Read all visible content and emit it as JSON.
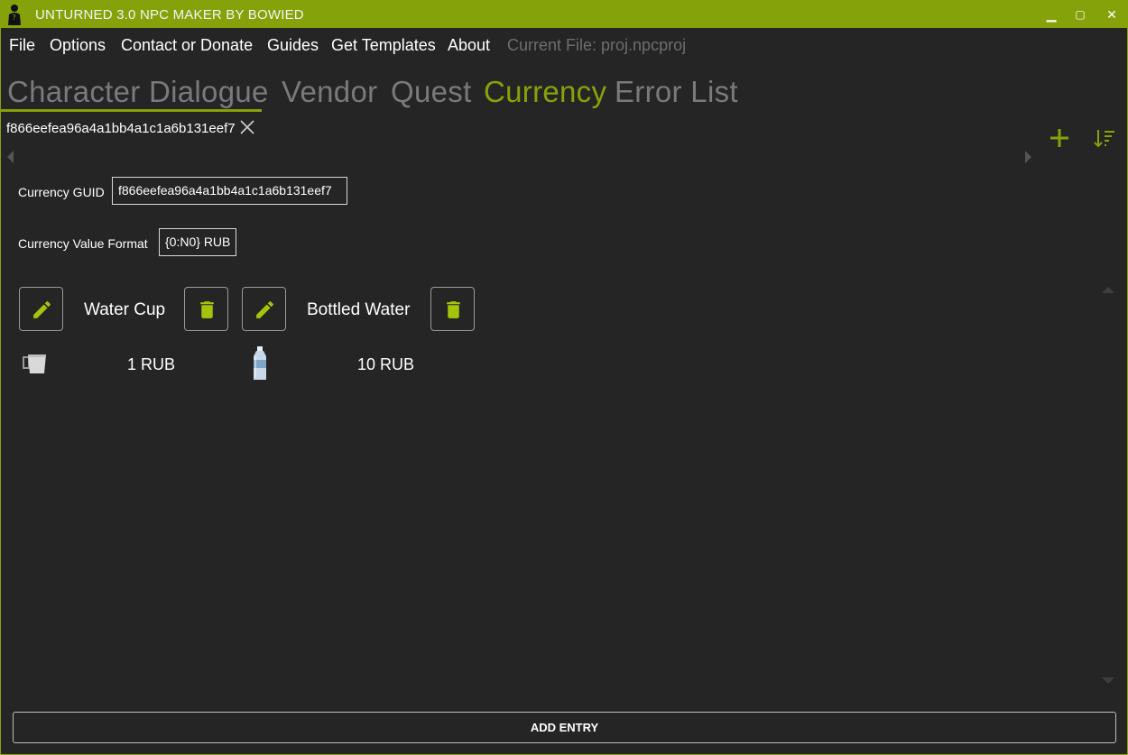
{
  "window": {
    "title": "UNTURNED 3.0 NPC MAKER BY BOWIED",
    "icon": "npc-silhouette-icon",
    "controls": {
      "minimize": "▁",
      "maximize": "▢",
      "close": "✕"
    }
  },
  "menu": {
    "items": [
      "File",
      "Options",
      "Contact or Donate",
      "Guides",
      "Get Templates",
      "About"
    ],
    "current_file": "Current File: proj.npcproj"
  },
  "tabs": {
    "items": [
      "Character",
      "Dialogue",
      "Vendor",
      "Quest",
      "Currency",
      "Error List"
    ],
    "active": "Currency"
  },
  "subtab": {
    "label": "f866eefea96a4a1bb4a1c1a6b131eef7"
  },
  "form": {
    "guid_label": "Currency GUID",
    "guid_value": "f866eefea96a4a1bb4a1c1a6b131eef7",
    "format_label": "Currency Value Format",
    "format_value": "{0:N0} RUB"
  },
  "entries": [
    {
      "name": "Water Cup",
      "price": "1 RUB",
      "icon": "water-cup-icon"
    },
    {
      "name": "Bottled Water",
      "price": "10 RUB",
      "icon": "bottled-water-icon"
    }
  ],
  "footer": {
    "add_entry": "ADD ENTRY"
  },
  "colors": {
    "accent": "#86a20a",
    "background": "#252525",
    "inactive_tab": "#7a7a7a"
  }
}
